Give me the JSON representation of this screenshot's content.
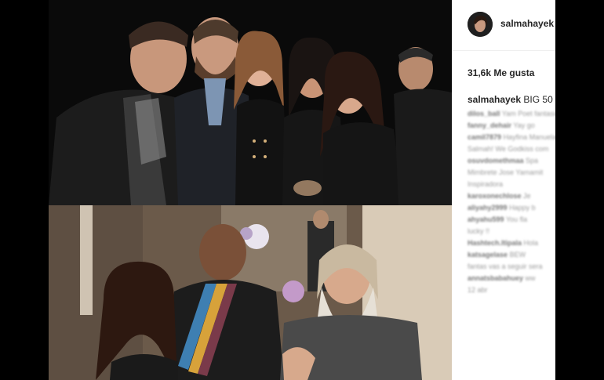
{
  "post": {
    "username": "salmahayek",
    "likes_text": "31,6k Me gusta",
    "caption_user": "salmahayek",
    "caption_text": "BIG 50"
  },
  "comments": [
    {
      "user": "dilos_ball",
      "text": "Yam Poet fantasia"
    },
    {
      "user": "fanny_dehair",
      "text": "Yay go"
    },
    {
      "user": "camil7879",
      "text": "Hayfina Manuela"
    },
    {
      "user": "",
      "text": "Salmah! We Godkiss com"
    },
    {
      "user": "osuvdomethmaa",
      "text": "Spa"
    },
    {
      "user": "",
      "text": "Mimbrete Jose Yamamit"
    },
    {
      "user": "",
      "text": "Inspiradora"
    },
    {
      "user": "karoxonechlose",
      "text": "Je"
    },
    {
      "user": "aliyahy2999",
      "text": "Happy b"
    },
    {
      "user": "ahyahu599",
      "text": "You fla"
    },
    {
      "user": "",
      "text": "lucky !!"
    },
    {
      "user": "Hashtech.ltipala",
      "text": "Hola"
    },
    {
      "user": "katsagelase",
      "text": "BEW"
    },
    {
      "user": "",
      "text": "fantas vas a seguir sera"
    },
    {
      "user": "annatsbabahuey",
      "text": "ww"
    },
    {
      "user": "",
      "text": "12 abr"
    }
  ],
  "colors": {
    "text": "#262626",
    "muted": "#9a9a9a",
    "divider": "#efefef",
    "letterbox": "#000000"
  }
}
